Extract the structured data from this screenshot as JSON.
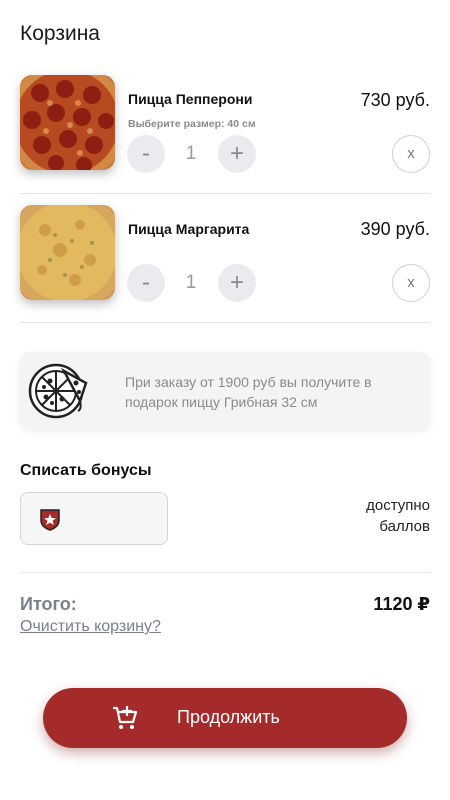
{
  "header": {
    "title": "Корзина"
  },
  "cart": {
    "items": [
      {
        "name": "Пицца Пепперони",
        "size_label": "Выберите размер: 40 см",
        "price": "730 руб.",
        "quantity": "1",
        "minus": "-",
        "plus": "+",
        "remove": "x"
      },
      {
        "name": "Пицца Маргарита",
        "size_label": "",
        "price": "390 руб.",
        "quantity": "1",
        "minus": "-",
        "plus": "+",
        "remove": "x"
      }
    ]
  },
  "promo": {
    "text": "При заказу от 1900 руб вы получите в подарок пиццу Грибная 32 см",
    "icon": "pizza-icon"
  },
  "bonus": {
    "title": "Списать бонусы",
    "available": "доступно баллов",
    "icon": "shield-star-icon",
    "value": ""
  },
  "summary": {
    "total_label": "Итого:",
    "total_value": "1120 ₽",
    "clear_label": "Очистить корзину?"
  },
  "action": {
    "continue_label": "Продолжить",
    "icon": "cart-add-icon"
  },
  "colors": {
    "accent": "#a52a2a",
    "muted": "#7a7f8f"
  }
}
